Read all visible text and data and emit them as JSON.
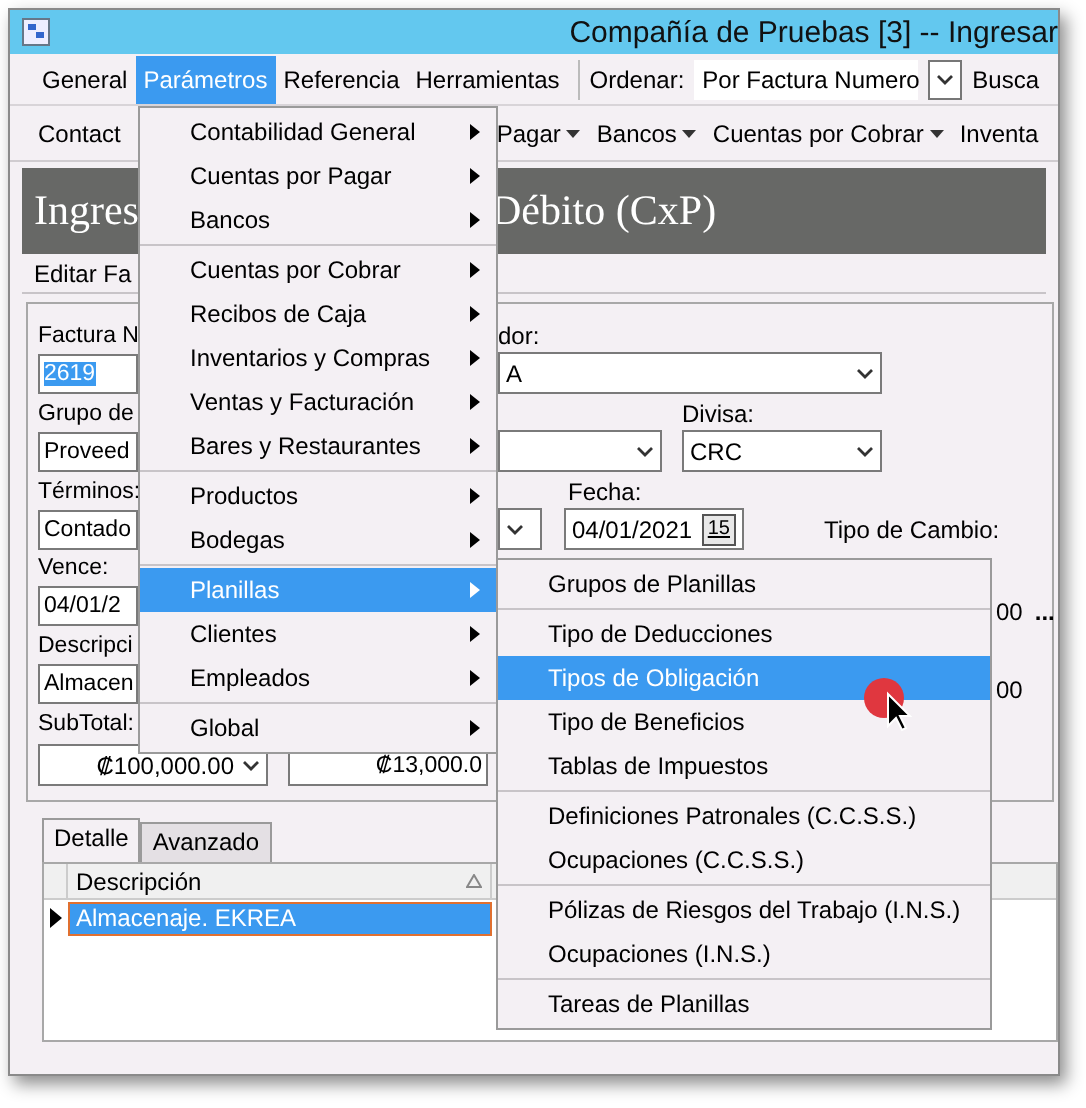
{
  "window": {
    "title": "Compañía de Pruebas [3] -- Ingresar"
  },
  "menu_bar": {
    "items": [
      {
        "label": "General",
        "selected": false
      },
      {
        "label": "Parámetros",
        "selected": true
      },
      {
        "label": "Referencia",
        "selected": false
      },
      {
        "label": "Herramientas",
        "selected": false
      }
    ],
    "sort_label": "Ordenar:",
    "sort_value": "Por Factura Numero",
    "search_label": "Busca"
  },
  "toolbar": {
    "left": [
      {
        "label": "Contact",
        "dropdown": false
      }
    ],
    "right": [
      {
        "label": "Pagar",
        "dropdown": true
      },
      {
        "label": "Bancos",
        "dropdown": true
      },
      {
        "label": "Cuentas por Cobrar",
        "dropdown": true
      },
      {
        "label": "Inventa",
        "dropdown": false
      }
    ]
  },
  "header": {
    "title_left": "Ingres",
    "title_right": "Débito (CxP)"
  },
  "edit_label": "Editar Fa",
  "form": {
    "factura_label": "Factura N",
    "factura_value": "2619",
    "factura_selected": true,
    "proveedor_label": "dor:",
    "proveedor_value": "A",
    "grupo_label": "Grupo de",
    "grupo_value": "Proveed",
    "divisa_label": "Divisa:",
    "divisa_value": "CRC",
    "terminos_label": "Términos:",
    "terminos_value": "Contado",
    "fecha_label": "Fecha:",
    "fecha_value": "04/01/2021",
    "calendar_day": "15",
    "vence_label": "Vence:",
    "vence_value": "04/01/2",
    "tipo_cambio_label": "Tipo de Cambio:",
    "tipo_cambio_value": "00",
    "tipo_cambio_button": "...",
    "descripcion_label": "Descripci",
    "descripcion_value": "Almacen",
    "other_value": "00",
    "subtotal_label": "SubTotal:",
    "subtotal_value": "₡100,000.00",
    "impuesto_value": "₡13,000.0"
  },
  "tabs": [
    {
      "label": "Detalle",
      "selected": true
    },
    {
      "label": "Avanzado",
      "selected": false
    }
  ],
  "grid": {
    "columns": [
      "Descripción"
    ],
    "rows": [
      {
        "cells": [
          "Almacenaje. EKREA"
        ],
        "selected": true
      }
    ]
  },
  "main_menu": {
    "groups": [
      [
        {
          "label": "Contabilidad General",
          "selected": false
        },
        {
          "label": "Cuentas por Pagar",
          "selected": false
        },
        {
          "label": "Bancos",
          "selected": false
        }
      ],
      [
        {
          "label": "Cuentas por Cobrar",
          "selected": false
        },
        {
          "label": "Recibos de Caja",
          "selected": false
        },
        {
          "label": "Inventarios y Compras",
          "selected": false
        },
        {
          "label": "Ventas y Facturación",
          "selected": false
        },
        {
          "label": "Bares y Restaurantes",
          "selected": false
        }
      ],
      [
        {
          "label": "Productos",
          "selected": false
        },
        {
          "label": "Bodegas",
          "selected": false
        }
      ],
      [
        {
          "label": "Planillas",
          "selected": true
        },
        {
          "label": "Clientes",
          "selected": false
        },
        {
          "label": "Empleados",
          "selected": false
        }
      ],
      [
        {
          "label": "Global",
          "selected": false
        }
      ]
    ]
  },
  "submenu": {
    "groups": [
      [
        {
          "label": "Grupos de Planillas",
          "selected": false
        }
      ],
      [
        {
          "label": "Tipo de Deducciones",
          "selected": false
        },
        {
          "label": "Tipos de Obligación",
          "selected": true
        },
        {
          "label": "Tipo de Beneficios",
          "selected": false
        },
        {
          "label": "Tablas de Impuestos",
          "selected": false
        }
      ],
      [
        {
          "label": "Definiciones Patronales (C.C.S.S.)",
          "selected": false
        },
        {
          "label": "Ocupaciones (C.C.S.S.)",
          "selected": false
        }
      ],
      [
        {
          "label": "Pólizas de Riesgos del Trabajo (I.N.S.)",
          "selected": false
        },
        {
          "label": "Ocupaciones (I.N.S.)",
          "selected": false
        }
      ],
      [
        {
          "label": "Tareas de Planillas",
          "selected": false
        }
      ]
    ]
  }
}
